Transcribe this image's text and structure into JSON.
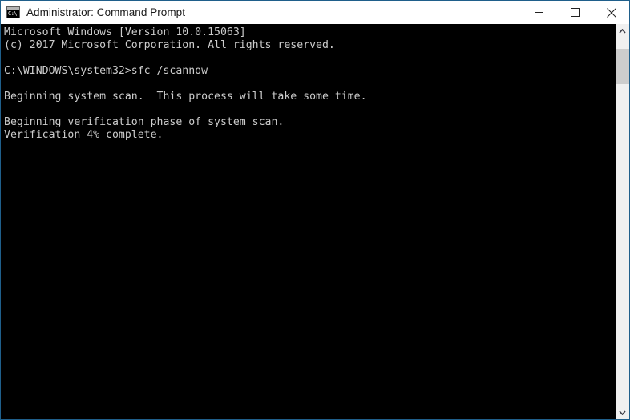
{
  "window": {
    "title": "Administrator: Command Prompt",
    "icon": "command-prompt-icon",
    "icon_glyph": "C:\\",
    "border_color": "#1f5f8b",
    "titlebar_background": "#ffffff",
    "titlebar_text_color": "#1a1a1a"
  },
  "caption_buttons": [
    {
      "name": "minimize-button",
      "label": "Minimize",
      "icon": "minimize-icon"
    },
    {
      "name": "maximize-button",
      "label": "Maximize",
      "icon": "maximize-icon"
    },
    {
      "name": "close-button",
      "label": "Close",
      "icon": "close-icon"
    }
  ],
  "console": {
    "background": "#000000",
    "foreground": "#cccccc",
    "lines": [
      "Microsoft Windows [Version 10.0.15063]",
      "(c) 2017 Microsoft Corporation. All rights reserved.",
      "",
      "C:\\WINDOWS\\system32>sfc /scannow",
      "",
      "Beginning system scan.  This process will take some time.",
      "",
      "Beginning verification phase of system scan.",
      "Verification 4% complete.",
      "",
      "",
      "",
      "",
      "",
      "",
      "",
      "",
      "",
      "",
      "",
      "",
      "",
      "",
      "",
      "",
      "",
      "",
      "",
      "",
      ""
    ],
    "command": "sfc /scannow",
    "prompt": "C:\\WINDOWS\\system32>",
    "progress_percent": "4%",
    "status_text": "Verification 4% complete."
  },
  "scrollbar": {
    "up_button": "scroll-up-icon",
    "down_button": "scroll-down-icon",
    "track_color": "#f0f0f0",
    "thumb_color": "#cdcdcd"
  }
}
